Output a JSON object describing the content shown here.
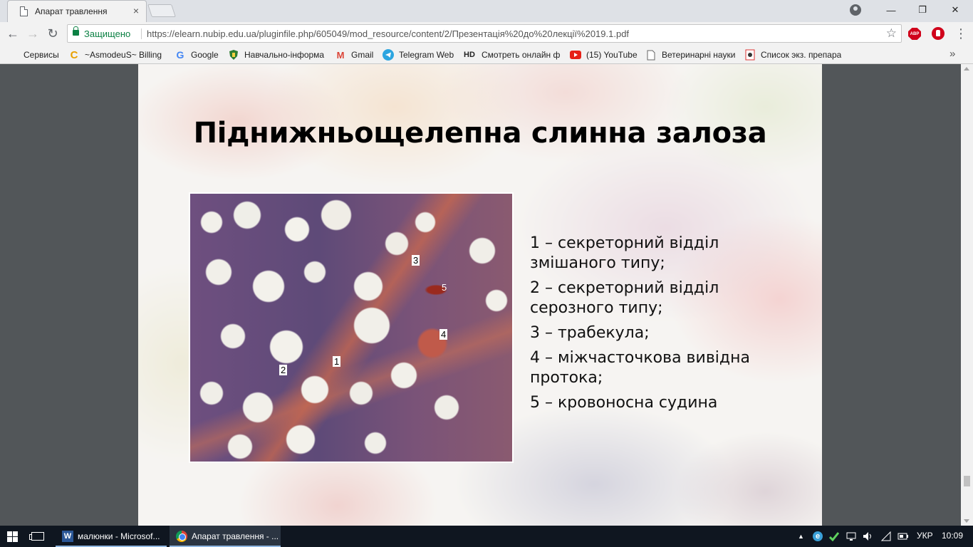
{
  "browser": {
    "tab_title": "Апарат травлення",
    "tab_close": "×",
    "window_minimize": "—",
    "window_restore": "❐",
    "window_close": "✕"
  },
  "toolbar": {
    "back": "←",
    "forward": "→",
    "reload": "↻",
    "secure_label": "Защищено",
    "url": "https://elearn.nubip.edu.ua/pluginfile.php/605049/mod_resource/content/2/Презентація%20до%20лекції%2019.1.pdf",
    "bookmark_star": "☆",
    "abp_label": "ABP",
    "menu": "⋮"
  },
  "bookmarks": {
    "items": [
      {
        "label": "Сервисы",
        "icon": "apps-icon"
      },
      {
        "label": "~AsmodeuS~ Billing",
        "icon": "billing-icon"
      },
      {
        "label": "Google",
        "icon": "google-icon"
      },
      {
        "label": "Навчально-інформа",
        "icon": "shield-icon"
      },
      {
        "label": "Gmail",
        "icon": "gmail-icon"
      },
      {
        "label": "Telegram Web",
        "icon": "telegram-icon"
      },
      {
        "label": "Смотреть онлайн фі",
        "icon": "hd-icon"
      },
      {
        "label": "(15) YouTube",
        "icon": "youtube-icon"
      },
      {
        "label": "Ветеринарні науки",
        "icon": "page-icon"
      },
      {
        "label": "Список экз. препара",
        "icon": "docs-icon"
      }
    ],
    "more": "»",
    "hd_text": "HD",
    "google_letter": "G",
    "gmail_letter": "M",
    "billing_letter": "C"
  },
  "slide": {
    "title": "Піднижньощелепна слинна залоза",
    "image_labels": [
      {
        "num": "1"
      },
      {
        "num": "2"
      },
      {
        "num": "3"
      },
      {
        "num": "4"
      },
      {
        "num": "5"
      }
    ],
    "legend": [
      "1 – секреторний відділ змішаного типу;",
      "2 – секреторний відділ серозного типу;",
      "3 – трабекула;",
      "4 – міжчасточкова вивідна протока;",
      "5 – кровоносна судина"
    ]
  },
  "taskbar": {
    "items": [
      {
        "label": "малюнки - Microsof...",
        "icon": "word-icon",
        "active": false
      },
      {
        "label": "Апарат травлення - ...",
        "icon": "chrome-icon",
        "active": true
      }
    ],
    "word_letter": "W",
    "tray_chevron": "▲",
    "language": "УКР",
    "time": "10:09",
    "edge_letter": "e"
  },
  "colors": {
    "secure_green": "#0b8043",
    "abp_red": "#d0021b",
    "taskbar_bg": "#0f1620",
    "viewer_bg": "#525659"
  }
}
